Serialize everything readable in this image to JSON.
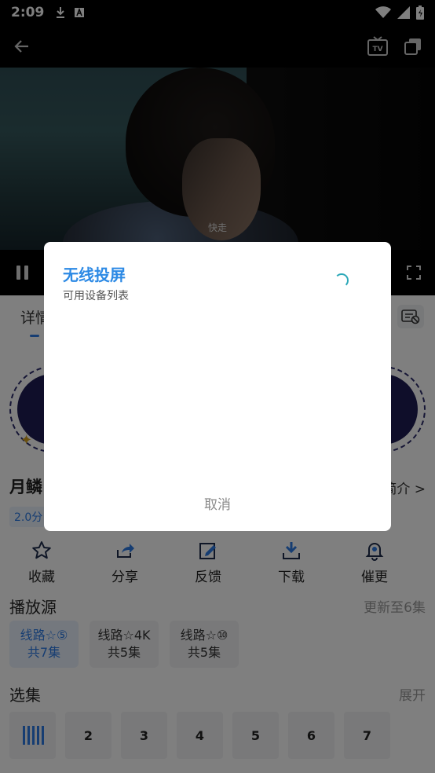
{
  "status_bar": {
    "time": "2:09"
  },
  "video": {
    "subtitle": "快走"
  },
  "details_tab": {
    "label": "详情"
  },
  "show": {
    "title": "月鳞",
    "score": "2.0分",
    "intro_link": "简介 >"
  },
  "actions": [
    {
      "label": "收藏",
      "icon": "star-icon"
    },
    {
      "label": "分享",
      "icon": "share-icon"
    },
    {
      "label": "反馈",
      "icon": "edit-icon"
    },
    {
      "label": "下载",
      "icon": "download-icon"
    },
    {
      "label": "催更",
      "icon": "bell-icon"
    }
  ],
  "sources_section": {
    "title": "播放源",
    "update_info": "更新至6集",
    "sources": [
      {
        "name": "线路☆⑤",
        "count": "共7集",
        "active": true
      },
      {
        "name": "线路☆4K",
        "count": "共5集",
        "active": false
      },
      {
        "name": "线路☆⑩",
        "count": "共5集",
        "active": false
      }
    ]
  },
  "episodes_section": {
    "title": "选集",
    "expand": "展开",
    "episodes": [
      "2",
      "3",
      "4",
      "5",
      "6",
      "7"
    ]
  },
  "dialog": {
    "title": "无线投屏",
    "subtitle": "可用设备列表",
    "cancel": "取消"
  },
  "colors": {
    "accent": "#2d7be5",
    "spinner": "#2ba8b8"
  }
}
